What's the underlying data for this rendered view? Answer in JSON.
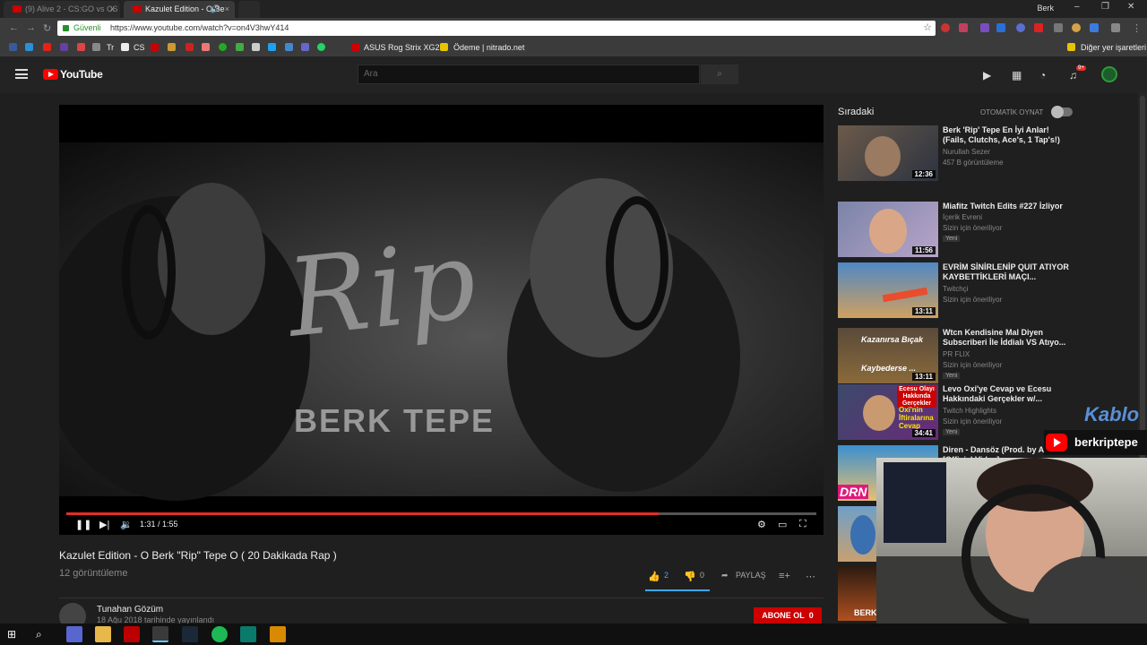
{
  "browser": {
    "tabs": [
      {
        "label": "(9) Alive 2 - CS:GO vs CS",
        "close": "×"
      },
      {
        "label": "Kazulet Edition - O Be",
        "close": "×",
        "audio": "🔊"
      }
    ],
    "user": "Berk",
    "secure_label": "Güvenli",
    "url": "https://www.youtube.com/watch?v=on4V3hwY414",
    "bookmarks": [
      {
        "label": "Tr"
      },
      {
        "label": "CS"
      },
      {
        "label": "ASUS Rog Strix XG25"
      },
      {
        "label": "Ödeme | nitrado.net"
      }
    ],
    "other_bookmarks": "Diğer yer işaretleri"
  },
  "youtube": {
    "logo_text": "YouTube",
    "search_placeholder": "Ara",
    "notification_count": "9+",
    "player": {
      "overlay_title": "Rip",
      "overlay_subtitle": "BERK TEPE",
      "time": "1:31 / 1:55",
      "progress": 0.79
    },
    "video": {
      "title": "Kazulet Edition - O Berk \"Rip\" Tepe O ( 20 Dakikada Rap )",
      "views": "12 görüntüleme",
      "likes": "2",
      "dislikes": "0",
      "share": "PAYLAŞ"
    },
    "channel": {
      "name": "Tunahan Gözüm",
      "date": "18 Ağu 2018 tarihinde yayınlandı",
      "subscribe": "ABONE OL",
      "sub_count": "0"
    },
    "sidebar": {
      "up_next": "Sıradaki",
      "autoplay": "OTOMATİK OYNAT",
      "items": [
        {
          "title": "Berk 'Rip' Tepe En İyi Anlar! (Fails, Clutchs, Ace's, 1 Tap's!)",
          "channel": "Nurullah Sezer",
          "meta": "457 B görüntüleme",
          "badge": "",
          "duration": "12:36"
        },
        {
          "title": "Miafitz Twitch Edits #227 İzliyor",
          "channel": "İçerik Evreni",
          "meta": "Sizin için öneriliyor",
          "badge": "Yeni",
          "duration": "11:56"
        },
        {
          "title": "EVRİM SİNİRLENİP QUIT ATIYOR KAYBETTİKLERİ MAÇI...",
          "channel": "Twitchçi",
          "meta": "Sizin için öneriliyor",
          "badge": "",
          "duration": "13:11"
        },
        {
          "title": "Wtcn Kendisine Mal Diyen Subscriberi İle İddialı VS Atıyo...",
          "channel": "PR FLIX",
          "meta": "Sizin için öneriliyor",
          "badge": "Yeni",
          "duration": "13:11",
          "thumb_text": "Kazanırsa Bıçak",
          "thumb_text2": "Kaybederse ..."
        },
        {
          "title": "Levo Oxi'ye Cevap ve Ecesu Hakkındaki Gerçekler w/...",
          "channel": "Twitch Highlights",
          "meta": "Sizin için öneriliyor",
          "badge": "Yeni",
          "duration": "34:41",
          "thumb_text": "Ecesu Olayı Hakkında Gerçekler",
          "thumb_text2": "Oxi'nin İftiralarına Cevap"
        },
        {
          "title": "Diren - Dansöz (Prod. by Allame) [Official Video]",
          "thumb_text": "DRN"
        },
        {
          "title": ""
        },
        {
          "title": "",
          "thumb_text": "BERK"
        }
      ]
    }
  },
  "overlay": {
    "brand": "Kablo",
    "handle": "berkriptepe"
  }
}
